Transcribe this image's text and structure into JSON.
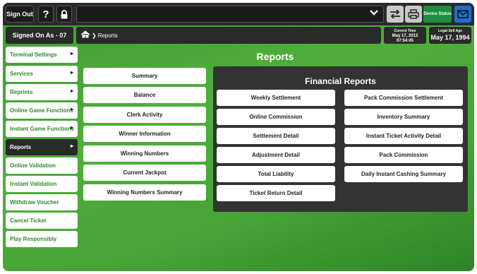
{
  "topbar": {
    "sign_out": "Sign Out",
    "help": "?",
    "device_status": "Device Status",
    "icons": [
      "lock-icon",
      "chevron-down-icon",
      "swap-icon",
      "printer-icon",
      "mail-icon"
    ]
  },
  "status": {
    "signed_on": "Signed On As - 07",
    "breadcrumb": "Reports",
    "current_time_label": "Current Time",
    "current_date": "May 17, 2012",
    "current_time": "07:54:45",
    "legal_label": "Legal Sell Age",
    "legal_date": "May 17, 1994"
  },
  "sidebar": {
    "items": [
      {
        "label": "Terminal Settings",
        "arrow": "▸"
      },
      {
        "label": "Services",
        "arrow": "▸"
      },
      {
        "label": "Reprints",
        "arrow": "▸"
      },
      {
        "label": "Online Game Functions",
        "arrow": "▸"
      },
      {
        "label": "Instant Game Functions",
        "arrow": "▸"
      },
      {
        "label": "Reports",
        "arrow": "▸"
      },
      {
        "label": "Online Validation",
        "arrow": ""
      },
      {
        "label": "Instant Validation",
        "arrow": ""
      },
      {
        "label": "Withdraw Voucher",
        "arrow": ""
      },
      {
        "label": "Cancel Ticket",
        "arrow": ""
      },
      {
        "label": "Play Responsibly",
        "arrow": ""
      }
    ]
  },
  "main": {
    "title": "Reports",
    "reports": [
      "Summary",
      "Balance",
      "Clerk Activity",
      "Winner Information",
      "Winning Numbers",
      "Current Jackpot",
      "Winning Numbers Summary"
    ],
    "financial": {
      "title": "Financial Reports",
      "items": [
        "Weekly Settlement",
        "Pack Commission Settlement",
        "Online Commission",
        "Inventory Summary",
        "Settlement Detail",
        "Instant Ticket Activity Detail",
        "Adjustment Detail",
        "Pack Commission",
        "Total Liability",
        "Daily Instant Cashing Summary",
        "Ticket Return Detail"
      ]
    }
  },
  "colors": {
    "background_green": "#4fae3b",
    "dark": "#2a2a2a",
    "sidebar_text": "#2e8a2a",
    "device_status": "#1e8e3e",
    "mail": "#1d6fd1"
  }
}
